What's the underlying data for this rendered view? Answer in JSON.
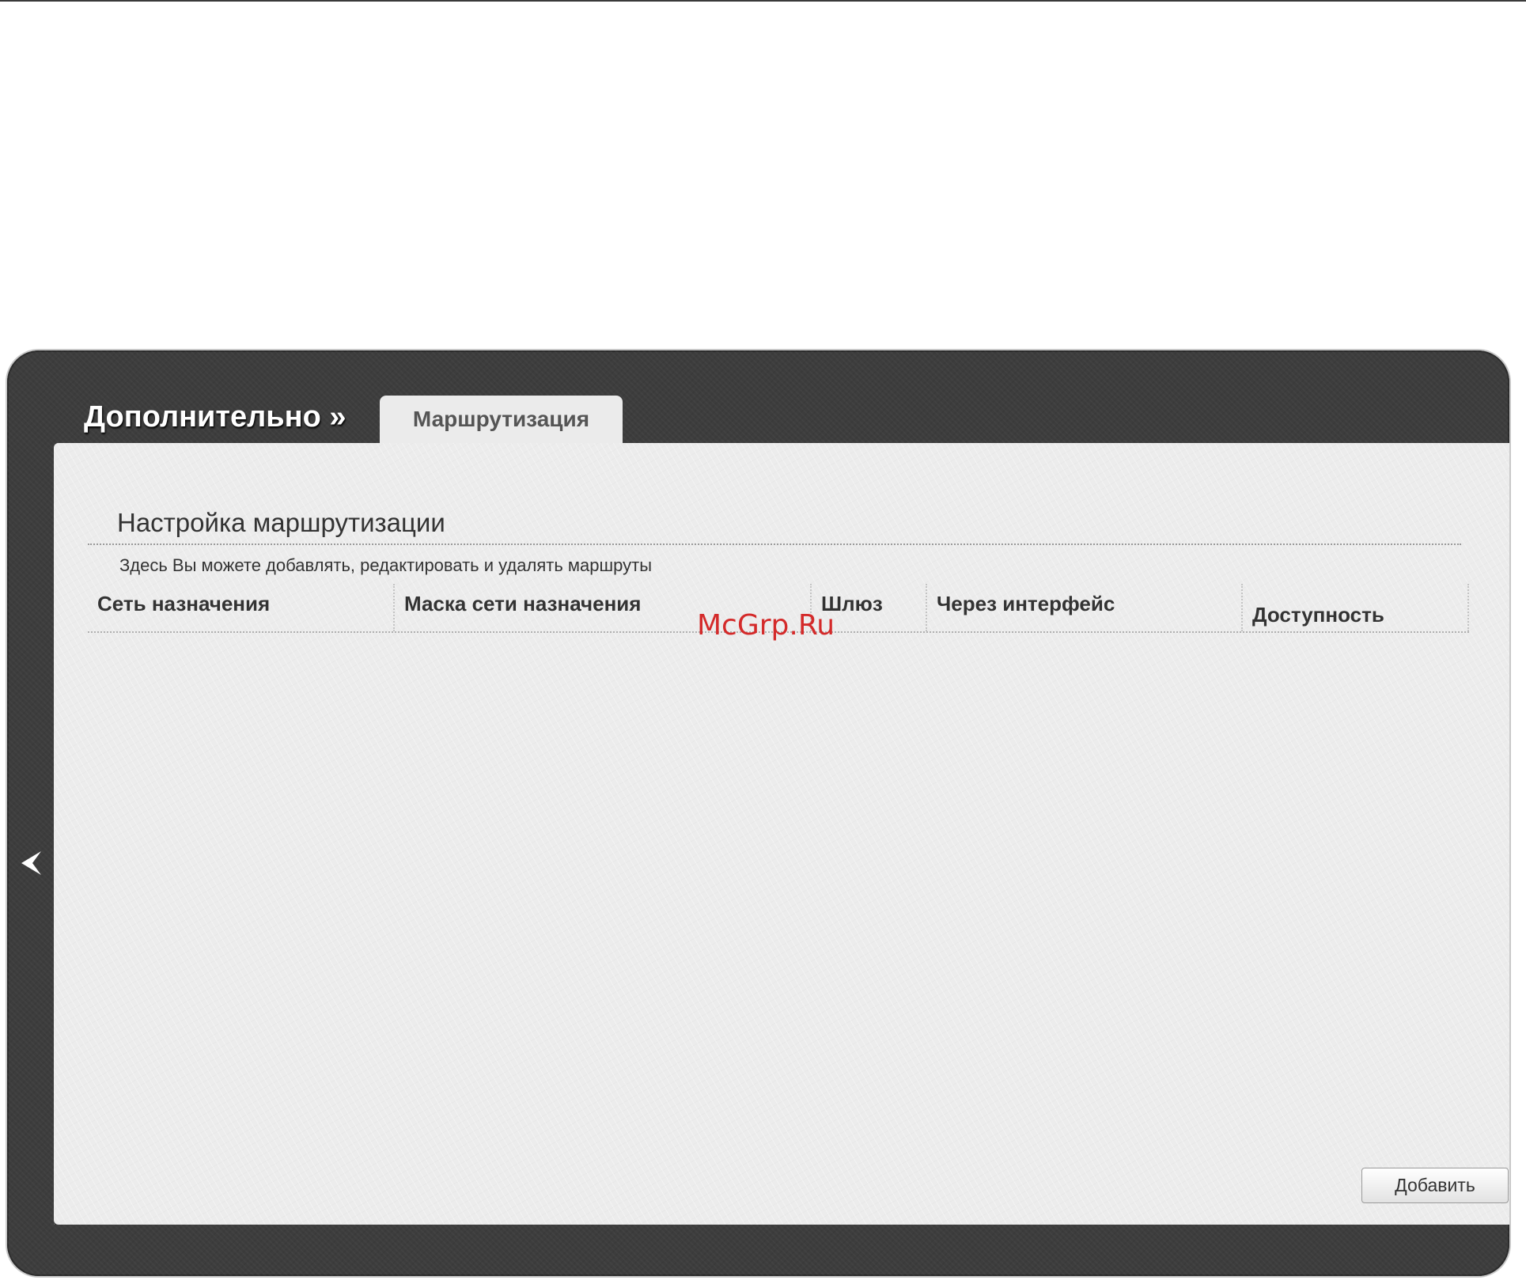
{
  "header": {
    "breadcrumb": "Дополнительно »",
    "active_tab": "Маршрутизация"
  },
  "section": {
    "title": "Настройка маршрутизации",
    "description": "Здесь Вы можете добавлять, редактировать и удалять маршруты"
  },
  "table": {
    "columns": [
      "Сеть назначения",
      "Маска сети назначения",
      "Шлюз",
      "Через интерфейс",
      "Доступность"
    ],
    "rows": []
  },
  "actions": {
    "add_label": "Добавить"
  },
  "navigation": {
    "back_icon": "chevron-left-icon"
  },
  "watermark": "McGrp.Ru",
  "colors": {
    "frame": "#3d3d3d",
    "panel": "#ececec",
    "tab": "#ebebeb",
    "watermark": "#d42a2a"
  }
}
